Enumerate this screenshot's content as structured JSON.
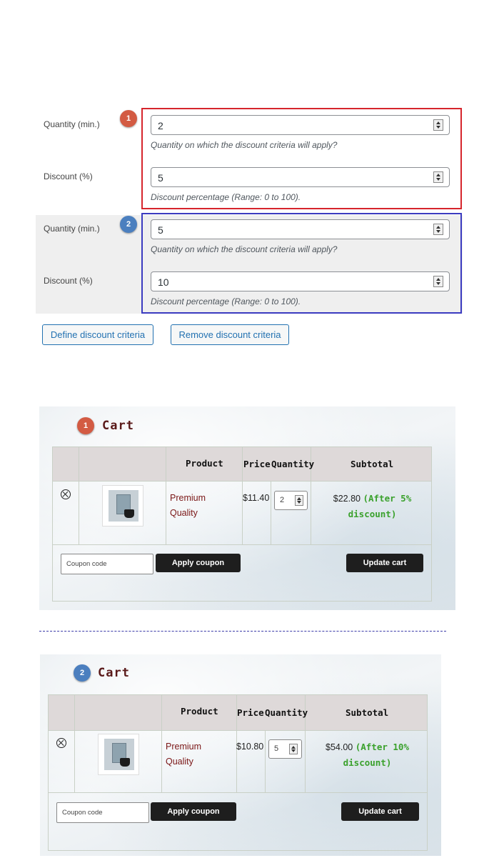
{
  "criteria_panel": {
    "blocks": [
      {
        "badge": "1",
        "quantity_label": "Quantity (min.)",
        "quantity_value": "2",
        "quantity_help": "Quantity on which the discount criteria will apply?",
        "discount_label": "Discount (%)",
        "discount_value": "5",
        "discount_help": "Discount percentage (Range: 0 to 100)."
      },
      {
        "badge": "2",
        "quantity_label": "Quantity (min.)",
        "quantity_value": "5",
        "quantity_help": "Quantity on which the discount criteria will apply?",
        "discount_label": "Discount (%)",
        "discount_value": "10",
        "discount_help": "Discount percentage (Range: 0 to 100)."
      }
    ],
    "define_button": "Define discount criteria",
    "remove_button": "Remove discount criteria"
  },
  "carts": [
    {
      "badge": "1",
      "title": "Cart",
      "columns": {
        "product": "Product",
        "price": "Price",
        "quantity": "Quantity",
        "subtotal": "Subtotal"
      },
      "item": {
        "name_line1": "Premium",
        "name_line2": "Quality",
        "price": "$11.40",
        "quantity": "2",
        "subtotal": "$22.80",
        "note_line1": "(After 5%",
        "note_line2": "discount)"
      },
      "coupon_placeholder": "Coupon code",
      "apply_coupon": "Apply coupon",
      "update_cart": "Update cart"
    },
    {
      "badge": "2",
      "title": "Cart",
      "columns": {
        "product": "Product",
        "price": "Price",
        "quantity": "Quantity",
        "subtotal": "Subtotal"
      },
      "item": {
        "name_line1": "Premium",
        "name_line2": "Quality",
        "price": "$10.80",
        "quantity": "5",
        "subtotal": "$54.00",
        "note_line1": "(After 10%",
        "note_line2": "discount)"
      },
      "coupon_placeholder": "Coupon code",
      "apply_coupon": "Apply coupon",
      "update_cart": "Update cart"
    }
  ],
  "colors": {
    "badge_1": "#d35b43",
    "badge_2": "#4b7fbf",
    "frame_1": "#d6252c",
    "frame_2": "#3b3bc0",
    "wp_link": "#2271b1",
    "discount_note": "#3aa12c",
    "product_name": "#7a1616"
  },
  "icons": [
    "spinner-arrows-icon",
    "remove-item-icon",
    "product-thumbnail-image"
  ]
}
